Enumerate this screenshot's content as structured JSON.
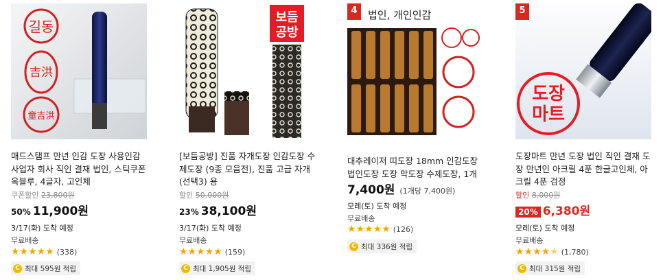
{
  "products": [
    {
      "title": "매드스탬프 만년 인감 도장 사용인감 사업자 회사 직인 결재 법인, 스틱쿠폰 옥블루, 4글자, 고인체",
      "orig_label": "쿠폰할인",
      "orig_price": "23,800원",
      "discount": "50%",
      "price": "11,900원",
      "unit_price": "",
      "delivery": "3/17(화) 도착 예정",
      "shipping": "무료배송",
      "rating": 5,
      "review_count": "(338)",
      "points": "최대 595원 적립",
      "thumb_text": [
        "길동",
        "吉洪",
        "童吉洪"
      ]
    },
    {
      "title": "[보듬공방] 진품 자개도장 인감도장 수제도장 (9종 모음전), 진품 고급 자개 (선택3) 용",
      "orig_label": "할인",
      "orig_price": "50,000원",
      "discount": "23%",
      "price": "38,100원",
      "unit_price": "",
      "delivery": "3/17(화) 도착 예정",
      "shipping": "무료배송",
      "rating": 5,
      "review_count": "(159)",
      "points": "최대 1,905원 적립",
      "thumb_text": [
        "보듬",
        "공방"
      ]
    },
    {
      "rank": "4",
      "title": "대추레이저 띠도장 18mm 인감도장 법인도장 도장 막도장 수제도장, 1개",
      "price": "7,400원",
      "unit_price": "(1개당 7,400원)",
      "delivery": "모레(토) 도착 예정",
      "shipping": "무료배송",
      "rating": 5,
      "review_count": "(126)",
      "points": "최대 336원 적립",
      "thumb_text": [
        "법인, 개인인감"
      ]
    },
    {
      "rank": "5",
      "title": "도장마트 만년 도장 법인 직인 결재 도장 만년인 아크릴 4푼 한글고인체, 아크릴 4푼 검정",
      "orig_label": "할인",
      "orig_price": "8,000원",
      "discount": "20%",
      "price": "6,380원",
      "unit_price": "",
      "delivery": "모레(토) 도착 예정",
      "shipping": "무료배송",
      "rating": 4.5,
      "review_count": "(1,780)",
      "points": "최대 315원 적립",
      "thumb_text": [
        "도장",
        "마트"
      ]
    }
  ],
  "colors": {
    "accent_red": "#d9281f",
    "star": "#f5a500",
    "coin": "#f5b800"
  }
}
